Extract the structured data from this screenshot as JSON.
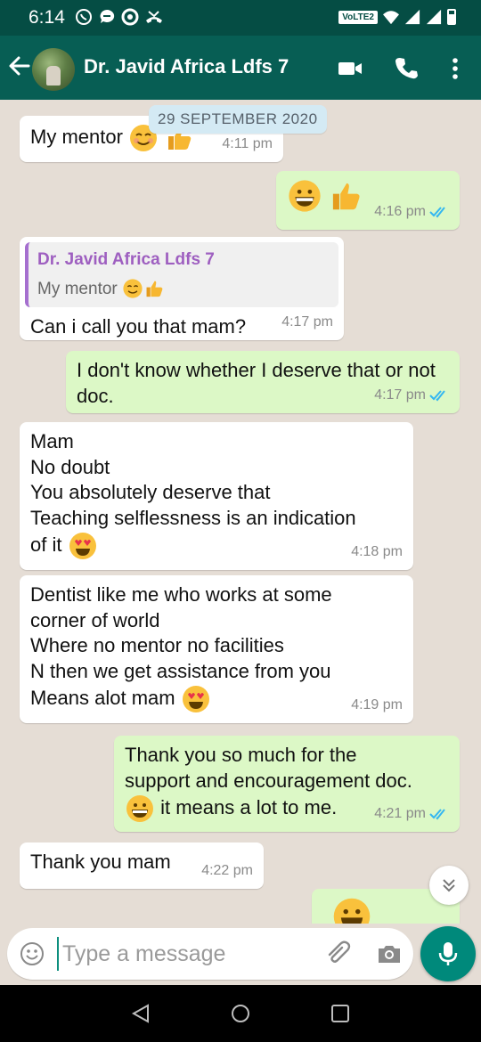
{
  "status_bar": {
    "time": "6:14",
    "network_badge": "VoLTE2",
    "notification_icons": [
      "whatsapp-icon",
      "messenger-icon",
      "record-icon",
      "missed-call-icon"
    ]
  },
  "header": {
    "contact_name": "Dr. Javid Africa Ldfs 7",
    "icons": [
      "back-arrow-icon",
      "video-call-icon",
      "phone-icon",
      "more-vert-icon"
    ]
  },
  "chat": {
    "date_chip": "29 SEPTEMBER 2020",
    "messages": [
      {
        "direction": "in",
        "text": "My mentor",
        "emoji": [
          "smiling-face",
          "thumbs-up"
        ],
        "time": "4:11 pm"
      },
      {
        "direction": "out",
        "text": "",
        "emoji": [
          "grinning-face",
          "thumbs-up"
        ],
        "time": "4:16 pm",
        "read": true
      },
      {
        "direction": "in",
        "quote": {
          "name": "Dr. Javid Africa Ldfs 7",
          "text": "My mentor",
          "emoji": [
            "smiling-face",
            "thumbs-up"
          ]
        },
        "text": "Can i call you that mam?",
        "time": "4:17 pm"
      },
      {
        "direction": "out",
        "text": "I don't know whether I deserve that or not doc.",
        "time": "4:17 pm",
        "read": true
      },
      {
        "direction": "in",
        "lines": [
          "Mam",
          "No doubt",
          "You absolutely deserve that",
          "Teaching selflessness is an indication",
          "of it"
        ],
        "emoji": [
          "heart-eyes"
        ],
        "time": "4:18 pm"
      },
      {
        "direction": "in",
        "lines": [
          "Dentist like me who works at some",
          "corner of world",
          "Where no mentor no facilities",
          "N then we get assistance from you",
          "Means alot mam"
        ],
        "emoji": [
          "heart-eyes"
        ],
        "time": "4:19 pm"
      },
      {
        "direction": "out",
        "lines": [
          "Thank you so much for the",
          "support and encouragement doc.",
          " it means a lot to me."
        ],
        "emoji": [
          "grinning-face"
        ],
        "time": "4:21 pm",
        "read": true
      },
      {
        "direction": "in",
        "text": "Thank you mam",
        "time": "4:22 pm"
      },
      {
        "direction": "out",
        "text": "",
        "emoji": [
          "grinning-face"
        ],
        "time": "",
        "partial": true
      }
    ]
  },
  "input": {
    "placeholder": "Type a message"
  },
  "colors": {
    "header": "#075e54",
    "status_bar": "#054d44",
    "chat_bg": "#e5ddd5",
    "outgoing_bubble": "#dcf8c6",
    "incoming_bubble": "#ffffff",
    "read_tick": "#34b7f1",
    "quote_name": "#9e5fc0",
    "mic_button": "#00897b"
  }
}
